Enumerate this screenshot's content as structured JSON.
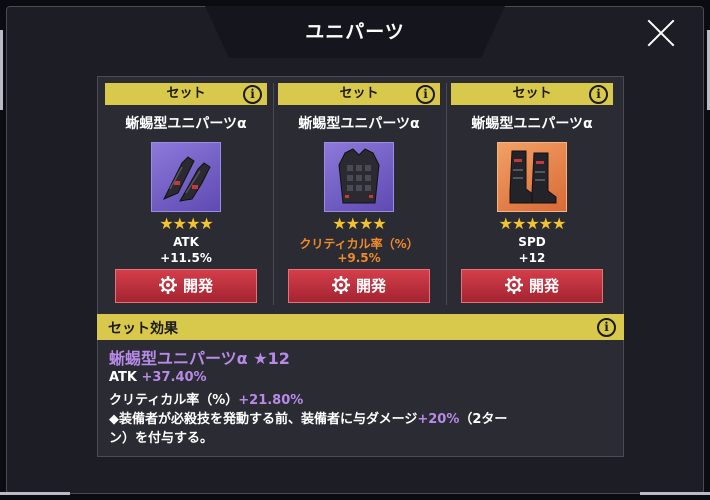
{
  "window": {
    "title": "ユニパーツ",
    "close_icon": "close-icon"
  },
  "cards": [
    {
      "set_label": "セット",
      "name": "蜥蜴型ユニパーツα",
      "icon": "gauntlets-icon",
      "rarity": "purple",
      "stars": "★★★★",
      "stat_name": "ATK",
      "stat_value": "+11.5%",
      "stat_highlight": false,
      "button_label": "開発"
    },
    {
      "set_label": "セット",
      "name": "蜥蜴型ユニパーツα",
      "icon": "armor-vest-icon",
      "rarity": "purple",
      "stars": "★★★★",
      "stat_name": "クリティカル率（%）",
      "stat_value": "+9.5%",
      "stat_highlight": true,
      "button_label": "開発"
    },
    {
      "set_label": "セット",
      "name": "蜥蜴型ユニパーツα",
      "icon": "boots-icon",
      "rarity": "orange",
      "stars": "★★★★★",
      "stat_name": "SPD",
      "stat_value": "+12",
      "stat_highlight": false,
      "button_label": "開発"
    }
  ],
  "set_effect": {
    "header": "セット効果",
    "name": "蜥蜴型ユニパーツα ★12",
    "lines": [
      {
        "label": "ATK",
        "value": "+37.40%"
      },
      {
        "label": "クリティカル率（%）",
        "value": "+21.80%"
      }
    ],
    "desc_prefix": "◆装備者が必殺技を発動する前、装備者に与ダメージ",
    "desc_value": "+20%",
    "desc_suffix": "（2ター",
    "desc_line2": "ン）を付与する。"
  },
  "colors": {
    "accent_yellow": "#d8c84c",
    "button_red": "#c0313d",
    "highlight_orange": "#f08a2c",
    "highlight_purple": "#b78ae8",
    "star_gold": "#f2c230"
  }
}
